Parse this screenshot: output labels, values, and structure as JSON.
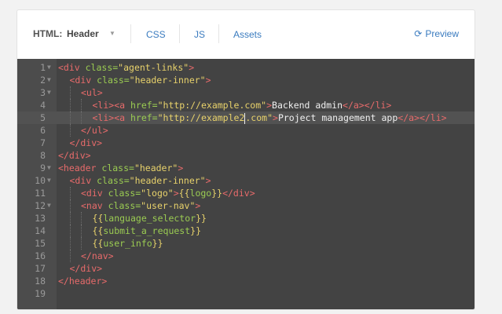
{
  "toolbar": {
    "html_label": "HTML:",
    "html_select_value": "Header",
    "tabs": [
      "CSS",
      "JS",
      "Assets"
    ],
    "preview_label": "Preview",
    "link_color": "#3a7bbf"
  },
  "editor": {
    "active_line": 5,
    "lines": [
      {
        "n": "1",
        "fold": true,
        "indent": 0,
        "tokens": [
          [
            "tag",
            "<div"
          ],
          [
            "attr",
            " class="
          ],
          [
            "str",
            "\"agent-links\""
          ],
          [
            "tag",
            ">"
          ]
        ]
      },
      {
        "n": "2",
        "fold": true,
        "indent": 1,
        "tokens": [
          [
            "tag",
            "<div"
          ],
          [
            "attr",
            " class="
          ],
          [
            "str",
            "\"header-inner\""
          ],
          [
            "tag",
            ">"
          ]
        ]
      },
      {
        "n": "3",
        "fold": true,
        "indent": 2,
        "tokens": [
          [
            "tag",
            "<ul>"
          ]
        ]
      },
      {
        "n": "4",
        "fold": false,
        "indent": 3,
        "tokens": [
          [
            "tag",
            "<li><a"
          ],
          [
            "attr",
            " href="
          ],
          [
            "str",
            "\"http://example.com\""
          ],
          [
            "tag",
            ">"
          ],
          [
            "txt",
            "Backend admin"
          ],
          [
            "tag",
            "</a></li>"
          ]
        ]
      },
      {
        "n": "5",
        "fold": false,
        "indent": 3,
        "tokens": [
          [
            "tag",
            "<li><a"
          ],
          [
            "attr",
            " href="
          ],
          [
            "str",
            "\"http://example2"
          ],
          [
            "cursor",
            ""
          ],
          [
            "str",
            ".com\""
          ],
          [
            "tag",
            ">"
          ],
          [
            "txt",
            "Project management app"
          ],
          [
            "tag",
            "</a></li>"
          ]
        ]
      },
      {
        "n": "6",
        "fold": false,
        "indent": 2,
        "tokens": [
          [
            "tag",
            "</ul>"
          ]
        ]
      },
      {
        "n": "7",
        "fold": false,
        "indent": 1,
        "tokens": [
          [
            "tag",
            "</div>"
          ]
        ]
      },
      {
        "n": "8",
        "fold": false,
        "indent": 0,
        "tokens": [
          [
            "tag",
            "</div>"
          ]
        ]
      },
      {
        "n": "9",
        "fold": true,
        "indent": 0,
        "tokens": [
          [
            "tag",
            "<header"
          ],
          [
            "attr",
            " class="
          ],
          [
            "str",
            "\"header\""
          ],
          [
            "tag",
            ">"
          ]
        ]
      },
      {
        "n": "10",
        "fold": true,
        "indent": 1,
        "tokens": [
          [
            "tag",
            "<div"
          ],
          [
            "attr",
            " class="
          ],
          [
            "str",
            "\"header-inner\""
          ],
          [
            "tag",
            ">"
          ]
        ]
      },
      {
        "n": "11",
        "fold": false,
        "indent": 2,
        "tokens": [
          [
            "tag",
            "<div"
          ],
          [
            "attr",
            " class="
          ],
          [
            "str",
            "\"logo\""
          ],
          [
            "tag",
            ">"
          ],
          [
            "brace",
            "{{"
          ],
          [
            "var",
            "logo"
          ],
          [
            "brace",
            "}}"
          ],
          [
            "tag",
            "</div>"
          ]
        ]
      },
      {
        "n": "12",
        "fold": true,
        "indent": 2,
        "tokens": [
          [
            "tag",
            "<nav"
          ],
          [
            "attr",
            " class="
          ],
          [
            "str",
            "\"user-nav\""
          ],
          [
            "tag",
            ">"
          ]
        ]
      },
      {
        "n": "13",
        "fold": false,
        "indent": 3,
        "tokens": [
          [
            "brace",
            "{{"
          ],
          [
            "var",
            "language_selector"
          ],
          [
            "brace",
            "}}"
          ]
        ]
      },
      {
        "n": "14",
        "fold": false,
        "indent": 3,
        "tokens": [
          [
            "brace",
            "{{"
          ],
          [
            "var",
            "submit_a_request"
          ],
          [
            "brace",
            "}}"
          ]
        ]
      },
      {
        "n": "15",
        "fold": false,
        "indent": 3,
        "tokens": [
          [
            "brace",
            "{{"
          ],
          [
            "var",
            "user_info"
          ],
          [
            "brace",
            "}}"
          ]
        ]
      },
      {
        "n": "16",
        "fold": false,
        "indent": 2,
        "tokens": [
          [
            "tag",
            "</nav>"
          ]
        ]
      },
      {
        "n": "17",
        "fold": false,
        "indent": 1,
        "tokens": [
          [
            "tag",
            "</div>"
          ]
        ]
      },
      {
        "n": "18",
        "fold": false,
        "indent": 0,
        "tokens": [
          [
            "tag",
            "</header>"
          ]
        ]
      },
      {
        "n": "19",
        "fold": false,
        "indent": 0,
        "tokens": []
      }
    ]
  }
}
